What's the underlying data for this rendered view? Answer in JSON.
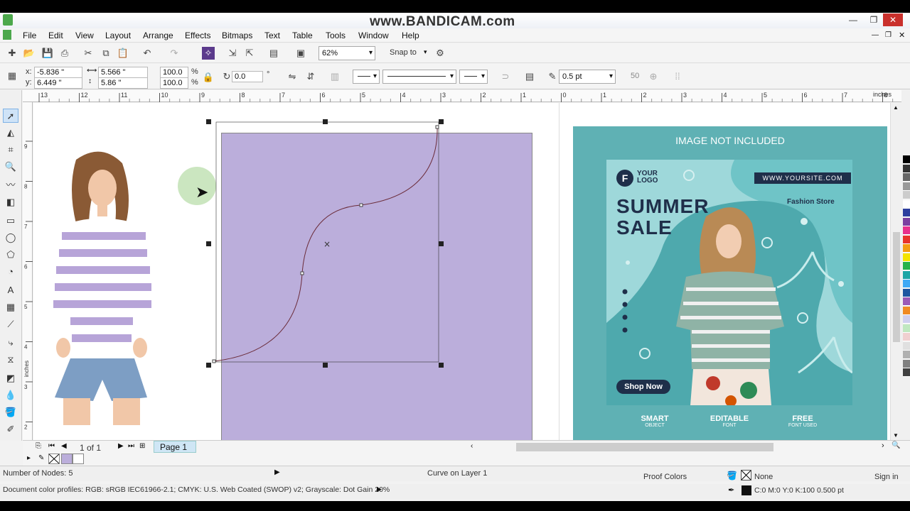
{
  "watermark": "www.BANDICAM.com",
  "menu": [
    "File",
    "Edit",
    "View",
    "Layout",
    "Arrange",
    "Effects",
    "Bitmaps",
    "Text",
    "Table",
    "Tools",
    "Window",
    "Help"
  ],
  "toolbar": {
    "zoom": "62%",
    "snap_to": "Snap to"
  },
  "property_bar": {
    "x_label": "x:",
    "x_value": "-5.836 \"",
    "y_label": "y:",
    "y_value": "6.449 \"",
    "w_value": "5.566 \"",
    "h_value": "5.86 \"",
    "scale_w": "100.0",
    "scale_h": "100.0",
    "percent": "%",
    "rotation": "0.0",
    "degree": "°",
    "outline_width": "0.5 pt",
    "miter": "50"
  },
  "ruler": {
    "unit": "inches",
    "h_ticks": [
      "13",
      "12",
      "11",
      "10",
      "9",
      "8",
      "7",
      "6",
      "5",
      "4",
      "3",
      "2",
      "1",
      "0",
      "1",
      "2",
      "3",
      "4",
      "5",
      "6",
      "7",
      "8"
    ],
    "v_ticks": [
      "9",
      "8",
      "7",
      "6",
      "5",
      "4",
      "3",
      "2"
    ],
    "v_unit": "inches"
  },
  "poster": {
    "caption": "IMAGE NOT INCLUDED",
    "logo_line1": "YOUR",
    "logo_line2": "LOGO",
    "logo_letter": "F",
    "website": "WWW.YOURSITE.COM",
    "headline1": "SUMMER",
    "headline2": "SALE",
    "store": "Fashion Store",
    "cta": "Shop Now",
    "features": [
      {
        "title": "SMART",
        "sub": "OBJECT"
      },
      {
        "title": "EDITABLE",
        "sub": "FONT"
      },
      {
        "title": "FREE",
        "sub": "FONT USED"
      }
    ]
  },
  "pagebar": {
    "page_count": "1 of 1",
    "page_tab": "Page 1"
  },
  "status": {
    "nodes": "Number of Nodes: 5",
    "object": "Curve on Layer 1",
    "proof": "Proof Colors",
    "fill": "None",
    "sign_in": "Sign in",
    "profiles": "Document color profiles: RGB: sRGB IEC61966-2.1; CMYK: U.S. Web Coated (SWOP) v2; Grayscale: Dot Gain 20%",
    "outline": "C:0 M:0 Y:0 K:100  0.500 pt"
  },
  "colors": {
    "lavender_rect": "#bbaedb",
    "poster_bg": "#5fb1b4",
    "poster_inner": "#9ed8da",
    "navy": "#1f2f4a"
  },
  "palette": [
    "#000000",
    "#333333",
    "#666666",
    "#999999",
    "#cccccc",
    "#ffffff",
    "#2c3e9e",
    "#7b3fa0",
    "#e8308c",
    "#e8332a",
    "#f39c12",
    "#f4e400",
    "#26b34a",
    "#1ba5a6",
    "#3fa9f5",
    "#1e56a0",
    "#9b59b6",
    "#f08a24",
    "#d0d0f0",
    "#c0e8c0",
    "#f0d0d0",
    "#e0e0e0",
    "#b0b0b0",
    "#808080",
    "#404040"
  ]
}
